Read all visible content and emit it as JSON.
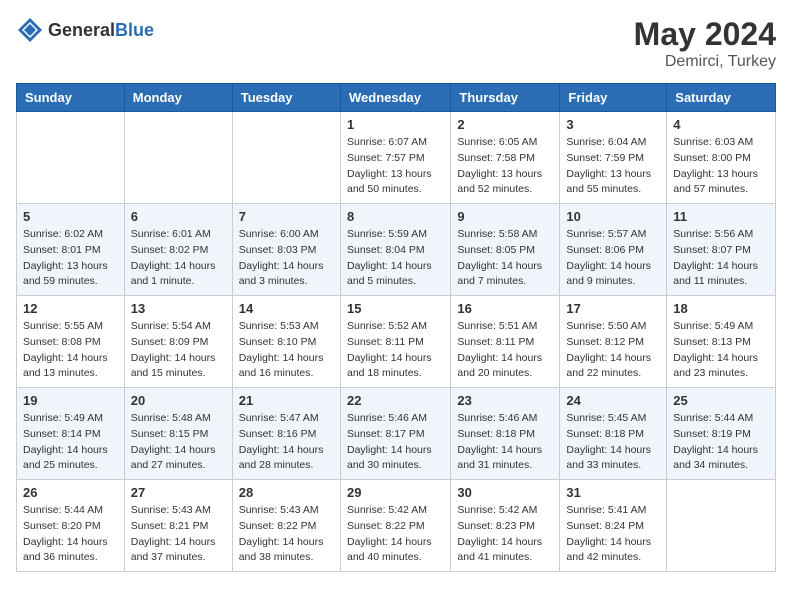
{
  "header": {
    "logo_general": "General",
    "logo_blue": "Blue",
    "title": "May 2024",
    "location": "Demirci, Turkey"
  },
  "days_of_week": [
    "Sunday",
    "Monday",
    "Tuesday",
    "Wednesday",
    "Thursday",
    "Friday",
    "Saturday"
  ],
  "weeks": [
    [
      {
        "day": "",
        "info": ""
      },
      {
        "day": "",
        "info": ""
      },
      {
        "day": "",
        "info": ""
      },
      {
        "day": "1",
        "info": "Sunrise: 6:07 AM\nSunset: 7:57 PM\nDaylight: 13 hours\nand 50 minutes."
      },
      {
        "day": "2",
        "info": "Sunrise: 6:05 AM\nSunset: 7:58 PM\nDaylight: 13 hours\nand 52 minutes."
      },
      {
        "day": "3",
        "info": "Sunrise: 6:04 AM\nSunset: 7:59 PM\nDaylight: 13 hours\nand 55 minutes."
      },
      {
        "day": "4",
        "info": "Sunrise: 6:03 AM\nSunset: 8:00 PM\nDaylight: 13 hours\nand 57 minutes."
      }
    ],
    [
      {
        "day": "5",
        "info": "Sunrise: 6:02 AM\nSunset: 8:01 PM\nDaylight: 13 hours\nand 59 minutes."
      },
      {
        "day": "6",
        "info": "Sunrise: 6:01 AM\nSunset: 8:02 PM\nDaylight: 14 hours\nand 1 minute."
      },
      {
        "day": "7",
        "info": "Sunrise: 6:00 AM\nSunset: 8:03 PM\nDaylight: 14 hours\nand 3 minutes."
      },
      {
        "day": "8",
        "info": "Sunrise: 5:59 AM\nSunset: 8:04 PM\nDaylight: 14 hours\nand 5 minutes."
      },
      {
        "day": "9",
        "info": "Sunrise: 5:58 AM\nSunset: 8:05 PM\nDaylight: 14 hours\nand 7 minutes."
      },
      {
        "day": "10",
        "info": "Sunrise: 5:57 AM\nSunset: 8:06 PM\nDaylight: 14 hours\nand 9 minutes."
      },
      {
        "day": "11",
        "info": "Sunrise: 5:56 AM\nSunset: 8:07 PM\nDaylight: 14 hours\nand 11 minutes."
      }
    ],
    [
      {
        "day": "12",
        "info": "Sunrise: 5:55 AM\nSunset: 8:08 PM\nDaylight: 14 hours\nand 13 minutes."
      },
      {
        "day": "13",
        "info": "Sunrise: 5:54 AM\nSunset: 8:09 PM\nDaylight: 14 hours\nand 15 minutes."
      },
      {
        "day": "14",
        "info": "Sunrise: 5:53 AM\nSunset: 8:10 PM\nDaylight: 14 hours\nand 16 minutes."
      },
      {
        "day": "15",
        "info": "Sunrise: 5:52 AM\nSunset: 8:11 PM\nDaylight: 14 hours\nand 18 minutes."
      },
      {
        "day": "16",
        "info": "Sunrise: 5:51 AM\nSunset: 8:11 PM\nDaylight: 14 hours\nand 20 minutes."
      },
      {
        "day": "17",
        "info": "Sunrise: 5:50 AM\nSunset: 8:12 PM\nDaylight: 14 hours\nand 22 minutes."
      },
      {
        "day": "18",
        "info": "Sunrise: 5:49 AM\nSunset: 8:13 PM\nDaylight: 14 hours\nand 23 minutes."
      }
    ],
    [
      {
        "day": "19",
        "info": "Sunrise: 5:49 AM\nSunset: 8:14 PM\nDaylight: 14 hours\nand 25 minutes."
      },
      {
        "day": "20",
        "info": "Sunrise: 5:48 AM\nSunset: 8:15 PM\nDaylight: 14 hours\nand 27 minutes."
      },
      {
        "day": "21",
        "info": "Sunrise: 5:47 AM\nSunset: 8:16 PM\nDaylight: 14 hours\nand 28 minutes."
      },
      {
        "day": "22",
        "info": "Sunrise: 5:46 AM\nSunset: 8:17 PM\nDaylight: 14 hours\nand 30 minutes."
      },
      {
        "day": "23",
        "info": "Sunrise: 5:46 AM\nSunset: 8:18 PM\nDaylight: 14 hours\nand 31 minutes."
      },
      {
        "day": "24",
        "info": "Sunrise: 5:45 AM\nSunset: 8:18 PM\nDaylight: 14 hours\nand 33 minutes."
      },
      {
        "day": "25",
        "info": "Sunrise: 5:44 AM\nSunset: 8:19 PM\nDaylight: 14 hours\nand 34 minutes."
      }
    ],
    [
      {
        "day": "26",
        "info": "Sunrise: 5:44 AM\nSunset: 8:20 PM\nDaylight: 14 hours\nand 36 minutes."
      },
      {
        "day": "27",
        "info": "Sunrise: 5:43 AM\nSunset: 8:21 PM\nDaylight: 14 hours\nand 37 minutes."
      },
      {
        "day": "28",
        "info": "Sunrise: 5:43 AM\nSunset: 8:22 PM\nDaylight: 14 hours\nand 38 minutes."
      },
      {
        "day": "29",
        "info": "Sunrise: 5:42 AM\nSunset: 8:22 PM\nDaylight: 14 hours\nand 40 minutes."
      },
      {
        "day": "30",
        "info": "Sunrise: 5:42 AM\nSunset: 8:23 PM\nDaylight: 14 hours\nand 41 minutes."
      },
      {
        "day": "31",
        "info": "Sunrise: 5:41 AM\nSunset: 8:24 PM\nDaylight: 14 hours\nand 42 minutes."
      },
      {
        "day": "",
        "info": ""
      }
    ]
  ]
}
